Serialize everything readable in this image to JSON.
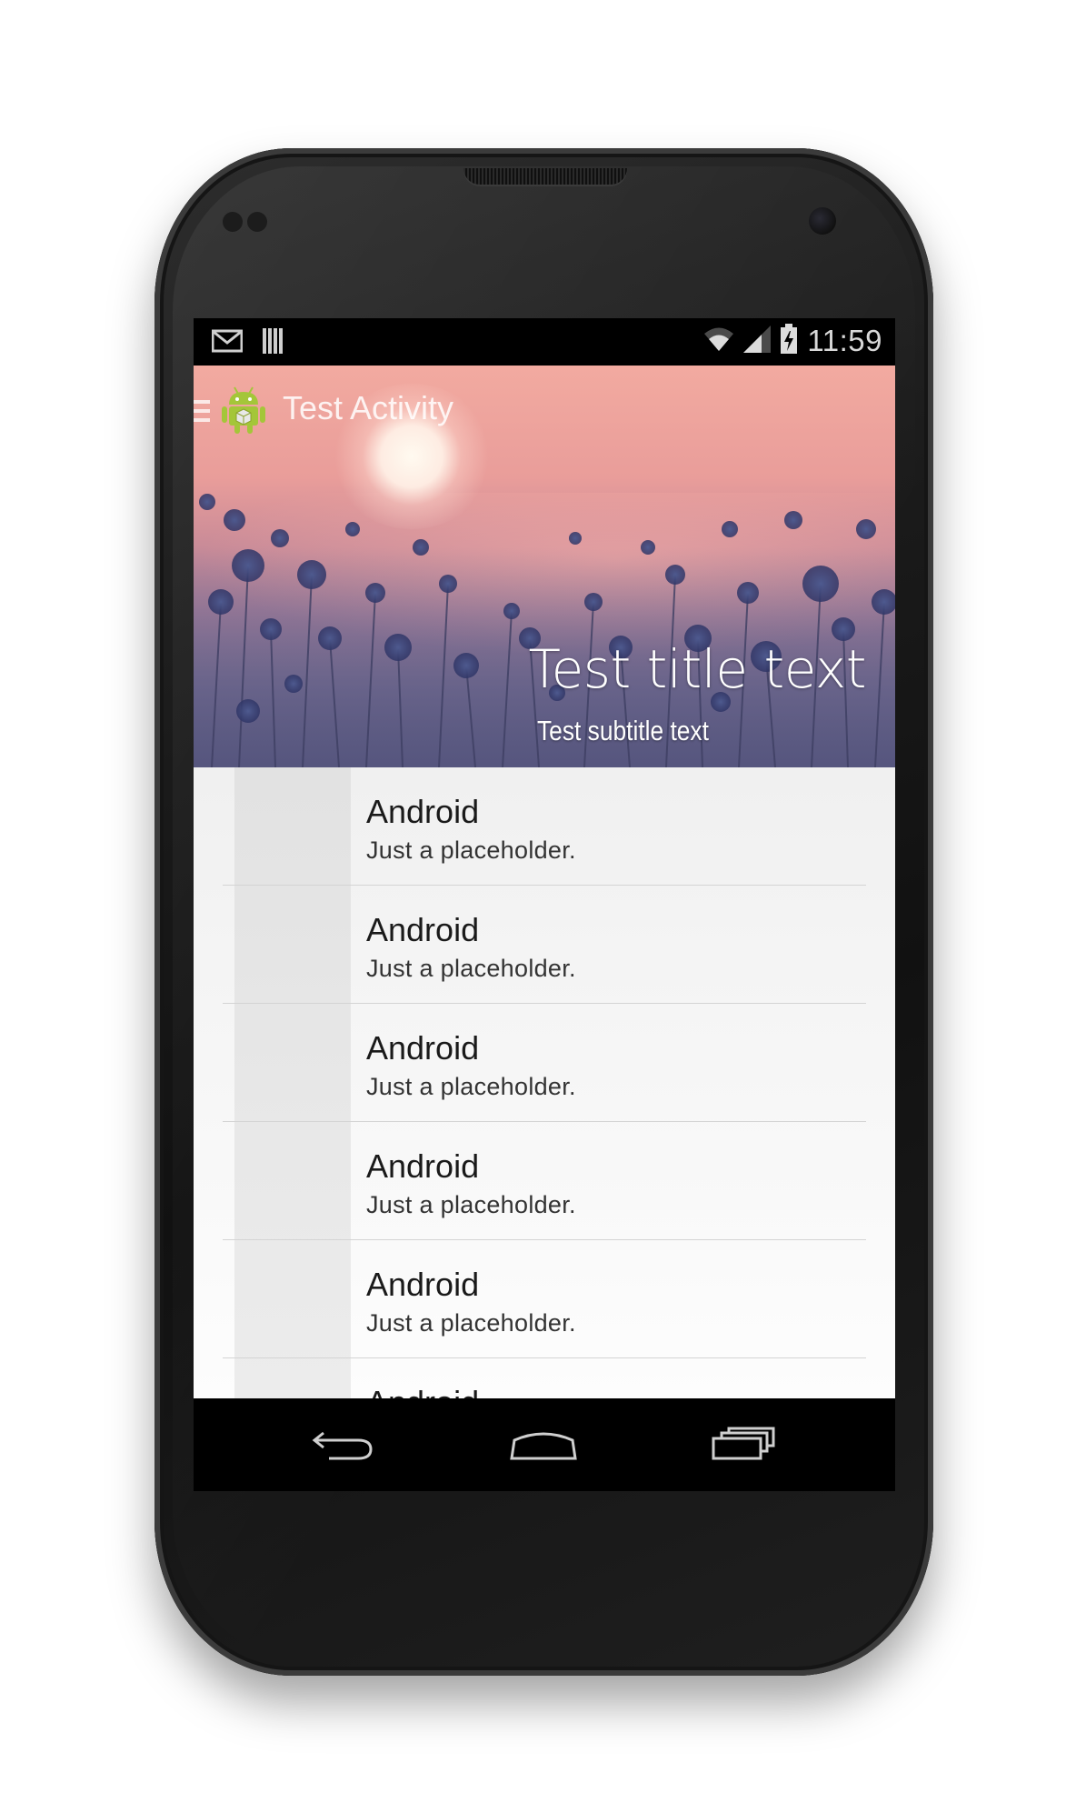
{
  "status_bar": {
    "time": "11:59",
    "icons": [
      "gmail-icon",
      "sim-card-icon",
      "wifi-icon",
      "cell-signal-icon",
      "battery-charging-icon"
    ]
  },
  "action_bar": {
    "title": "Test Activity",
    "menu_icon": "hamburger-menu-icon",
    "app_icon": "android-robot-icon"
  },
  "header": {
    "title": "Test title text",
    "subtitle": "Test subtitle text"
  },
  "list": {
    "items": [
      {
        "title": "Android",
        "subtitle": "Just a placeholder."
      },
      {
        "title": "Android",
        "subtitle": "Just a placeholder."
      },
      {
        "title": "Android",
        "subtitle": "Just a placeholder."
      },
      {
        "title": "Android",
        "subtitle": "Just a placeholder."
      },
      {
        "title": "Android",
        "subtitle": "Just a placeholder."
      },
      {
        "title": "Android",
        "subtitle": ""
      }
    ]
  },
  "nav_bar": {
    "icons": [
      "back-icon",
      "home-icon",
      "recent-apps-icon"
    ]
  },
  "colors": {
    "list_background": "#f4f4f4",
    "list_strip": "#e6e6e6",
    "divider": "#d4d4d4",
    "screen_black": "#000000"
  }
}
